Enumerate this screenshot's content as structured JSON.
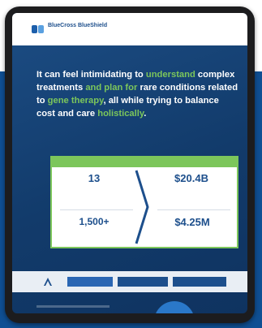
{
  "brand": {
    "name": "BlueCross BlueShield",
    "tagline": ""
  },
  "headline": {
    "parts": [
      {
        "text": "It can feel intimidating to ",
        "green": false
      },
      {
        "text": "understand",
        "green": true
      },
      {
        "text": " complex treatments ",
        "green": false
      },
      {
        "text": "and plan for",
        "green": true
      },
      {
        "text": " rare conditions related to ",
        "green": false
      },
      {
        "text": "gene therapy",
        "green": true
      },
      {
        "text": ", all while trying to balance cost and care ",
        "green": false
      },
      {
        "text": "holistically",
        "green": true
      },
      {
        "text": ".",
        "green": false
      }
    ]
  },
  "stats": {
    "banner": "",
    "left_top": {
      "value": "13",
      "desc": ""
    },
    "left_bottom": {
      "value": "1,500+",
      "desc": ""
    },
    "right_top": {
      "value": "$20.4B",
      "desc": ""
    },
    "right_bottom": {
      "value": "$4.25M",
      "prefix": "",
      "desc": ""
    }
  },
  "nav": {
    "btn1": "",
    "btn2": "",
    "btn3": ""
  },
  "colors": {
    "accent_green": "#7cc65b",
    "brand_blue": "#1d4f8c",
    "backdrop_blue": "#0f4f93"
  }
}
